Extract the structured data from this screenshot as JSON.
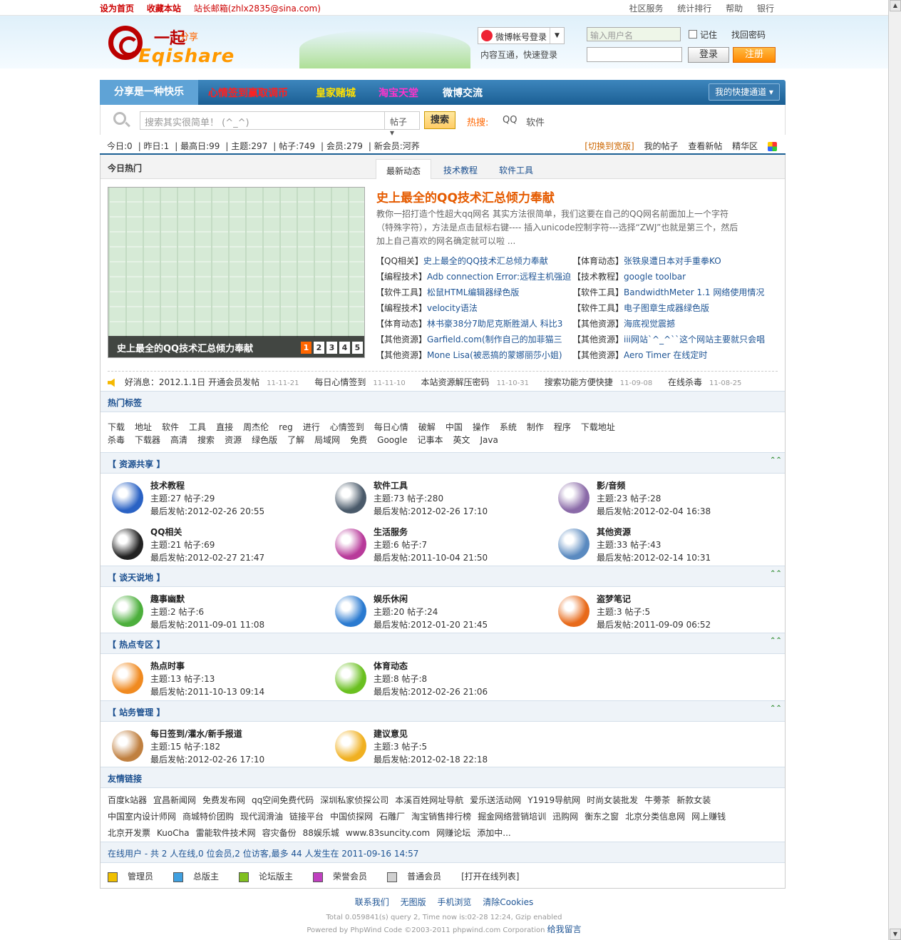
{
  "topbar": {
    "set_home": "设为首页",
    "bookmark": "收藏本站",
    "email": "站长邮箱(zhlx2835@sina.com)",
    "right": [
      "社区服务",
      "统计排行",
      "帮助",
      "银行"
    ]
  },
  "header": {
    "logo_cn": "一起",
    "logo_cn2": "分享",
    "logo_en": "Eqishare",
    "weibo_login": "微博帐号登录",
    "login_sub": "内容互通，快速登录",
    "username_placeholder": "输入用户名",
    "remember": "记住",
    "forgot": "找回密码",
    "login_btn": "登录",
    "register_btn": "注册"
  },
  "nav": {
    "current": "分享是一种快乐",
    "items": [
      {
        "label": "心情签到赢取调币",
        "color": "#ff2020"
      },
      {
        "label": "皇家赌城",
        "color": "#ffe000"
      },
      {
        "label": "淘宝天堂",
        "color": "#ff33cc"
      },
      {
        "label": "微博交流",
        "color": "#ffffff"
      }
    ],
    "quick": "我的快捷通道"
  },
  "search": {
    "placeholder": "搜索其实很简单！ (^_^)",
    "scope": "帖子",
    "button": "搜索",
    "hot_label": "热搜:",
    "hot": [
      "QQ",
      "软件"
    ]
  },
  "stats": {
    "today": "今日:0",
    "yesterday": "昨日:1",
    "max": "最高日:99",
    "topics": "主题:297",
    "posts": "帖子:749",
    "members": "会员:279",
    "newest": "新会员:河荞",
    "wide": "[切换到宽版]",
    "my_posts": "我的帖子",
    "new_posts": "查看新帖",
    "digest": "精华区"
  },
  "today": {
    "title": "今日热门",
    "tabs": [
      "最新动态",
      "技术教程",
      "软件工具"
    ],
    "slide_caption": "史上最全的QQ技术汇总倾力奉献",
    "slide_nums": [
      "1",
      "2",
      "3",
      "4",
      "5"
    ],
    "headline": "史上最全的QQ技术汇总倾力奉献",
    "summary": "教你一招打造个性超大qq网名 其实方法很简单，我们这要在自己的QQ网名前面加上一个字符（特殊字符），方法是点击鼠标右键---- 插入unicode控制字符---选择“ZWJ”也就是第三个，然后加上自己喜欢的网名确定就可以啦 ...",
    "news_left": [
      {
        "cat": "【QQ相关】",
        "title": "史上最全的QQ技术汇总倾力奉献"
      },
      {
        "cat": "【编程技术】",
        "title": "Adb connection Error:远程主机强迫"
      },
      {
        "cat": "【软件工具】",
        "title": "松鼠HTML编辑器绿色版"
      },
      {
        "cat": "【编程技术】",
        "title": "velocity语法"
      },
      {
        "cat": "【体育动态】",
        "title": "林书豪38分7助尼克斯胜湖人 科比3"
      },
      {
        "cat": "【其他资源】",
        "title": "Garfield.com(制作自己的加菲猫三"
      },
      {
        "cat": "【其他资源】",
        "title": "Mone Lisa(被恶搞的蒙娜丽莎小姐)"
      }
    ],
    "news_right": [
      {
        "cat": "【体育动态】",
        "title": "张铁泉遭日本对手重拳KO"
      },
      {
        "cat": "【技术教程】",
        "title": "google toolbar"
      },
      {
        "cat": "【软件工具】",
        "title": "BandwidthMeter 1.1 网络使用情况"
      },
      {
        "cat": "【软件工具】",
        "title": "电子图章生成器绿色版"
      },
      {
        "cat": "【其他资源】",
        "title": "海底视觉震撼"
      },
      {
        "cat": "【其他资源】",
        "title": "iii网站`^_^``这个网站主要就只会唱"
      },
      {
        "cat": "【其他资源】",
        "title": "Aero Timer 在线定时"
      }
    ],
    "notices": [
      {
        "text": "好消息：2012.1.1日 开通会员发帖",
        "date": "11-11-21"
      },
      {
        "text": "每日心情签到",
        "date": "11-11-10"
      },
      {
        "text": "本站资源解压密码",
        "date": "11-10-31"
      },
      {
        "text": "搜索功能方便快捷",
        "date": "11-09-08"
      },
      {
        "text": "在线杀毒",
        "date": "11-08-25"
      }
    ]
  },
  "tags": {
    "title": "热门标签",
    "row1": [
      "下载",
      "地址",
      "软件",
      "工具",
      "直接",
      "周杰伦",
      "reg",
      "进行",
      "心情签到",
      "每日心情",
      "破解",
      "中国",
      "操作",
      "系统",
      "制作",
      "程序",
      "下载地址"
    ],
    "row2": [
      "杀毒",
      "下载器",
      "高清",
      "搜索",
      "资源",
      "绿色版",
      "了解",
      "局域网",
      "免费",
      "Google",
      "记事本",
      "英文",
      "Java"
    ]
  },
  "sections": [
    {
      "title": "【 资源共享 】",
      "forums": [
        {
          "name": "技术教程",
          "stat": "主题:27  帖子:29",
          "last": "最后发帖:2012-02-26 20:55",
          "icon": "book-icon",
          "color": "#2a62c4"
        },
        {
          "name": "软件工具",
          "stat": "主题:73  帖子:280",
          "last": "最后发帖:2012-02-26 17:10",
          "icon": "compass-icon",
          "color": "#4a5a6a"
        },
        {
          "name": "影/音频",
          "stat": "主题:23  帖子:28",
          "last": "最后发帖:2012-02-04 16:38",
          "icon": "music-icon",
          "color": "#8a6aa8"
        },
        {
          "name": "QQ相关",
          "stat": "主题:21  帖子:69",
          "last": "最后发帖:2012-02-27 21:47",
          "icon": "penguin-icon",
          "color": "#222222"
        },
        {
          "name": "生活服务",
          "stat": "主题:6  帖子:7",
          "last": "最后发帖:2011-10-04 21:50",
          "icon": "triangle-icon",
          "color": "#b83a9a"
        },
        {
          "name": "其他资源",
          "stat": "主题:33  帖子:43",
          "last": "最后发帖:2012-02-14 10:31",
          "icon": "magnifier-icon",
          "color": "#5a8ac0"
        }
      ]
    },
    {
      "title": "【 谈天说地 】",
      "forums": [
        {
          "name": "趣事幽默",
          "stat": "主题:2  帖子:6",
          "last": "最后发帖:2011-09-01 11:08",
          "icon": "green-circle-icon",
          "color": "#4caf3c"
        },
        {
          "name": "娱乐休闲",
          "stat": "主题:20  帖子:24",
          "last": "最后发帖:2012-01-20 21:45",
          "icon": "people-icon",
          "color": "#2a7ad0"
        },
        {
          "name": "盗梦笔记",
          "stat": "主题:3  帖子:5",
          "last": "最后发帖:2011-09-09 06:52",
          "icon": "usb-icon",
          "color": "#e86a1a"
        }
      ]
    },
    {
      "title": "【 热点专区 】",
      "forums": [
        {
          "name": "热点时事",
          "stat": "主题:13  帖子:13",
          "last": "最后发帖:2011-10-13 09:14",
          "icon": "pie-icon",
          "color": "#f08a20"
        },
        {
          "name": "体育动态",
          "stat": "主题:8  帖子:8",
          "last": "最后发帖:2012-02-26 21:06",
          "icon": "lime-icon",
          "color": "#6ac020"
        }
      ]
    },
    {
      "title": "【 站务管理 】",
      "forums": [
        {
          "name": "每日签到/灌水/新手报道",
          "stat": "主题:15  帖子:182",
          "last": "最后发帖:2012-02-26 17:10",
          "icon": "heart-folder-icon",
          "color": "#c08040"
        },
        {
          "name": "建议意见",
          "stat": "主题:3  帖子:5",
          "last": "最后发帖:2012-02-18 22:18",
          "icon": "yellow-figure-icon",
          "color": "#f0b020"
        }
      ]
    }
  ],
  "friends": {
    "title": "友情链接",
    "row1": [
      "百度k站器",
      "宜昌新闻网",
      "免费发布网",
      "qq空间免费代码",
      "深圳私家侦探公司",
      "本溪百姓网址导航",
      "爱乐送活动网",
      "Y1919导航网",
      "时尚女装批发",
      "牛蒡茶",
      "新款女装"
    ],
    "row2": [
      "中国室内设计师网",
      "商城特价团购",
      "现代润滑油",
      "链接平台",
      "中国侦探网",
      "石雕厂",
      "淘宝销售排行榜",
      "掘金网络营销培训",
      "迅购网",
      "衡东之窗",
      "北京分类信息网",
      "网上赚钱"
    ],
    "row3": [
      "北京开发票",
      "KuoCha",
      "雷能软件技术网",
      "容灾备份",
      "88娱乐城",
      "www.83suncity.com",
      "网赚论坛",
      "添加中..."
    ]
  },
  "online": {
    "text": "在线用户 - 共 2 人在线,0 位会员,2 位访客,最多 44 人发生在 2011-09-16 14:57",
    "legend": [
      {
        "label": "管理员",
        "color": "#f0c000"
      },
      {
        "label": "总版主",
        "color": "#40a0e0"
      },
      {
        "label": "论坛版主",
        "color": "#80c020"
      },
      {
        "label": "荣誉会员",
        "color": "#c040c0"
      },
      {
        "label": "普通会员",
        "color": "#d0d0d0"
      }
    ],
    "open_list": "[打开在线列表]"
  },
  "footer": {
    "links": [
      "联系我们",
      "无图版",
      "手机浏览",
      "清除Cookies"
    ],
    "line2": "Total 0.059841(s) query 2, Time now is:02-28 12:24, Gzip enabled",
    "line3": "Powered by PhpWind Code ©2003-2011 phpwind.com Corporation",
    "guestbook": "给我留言"
  }
}
